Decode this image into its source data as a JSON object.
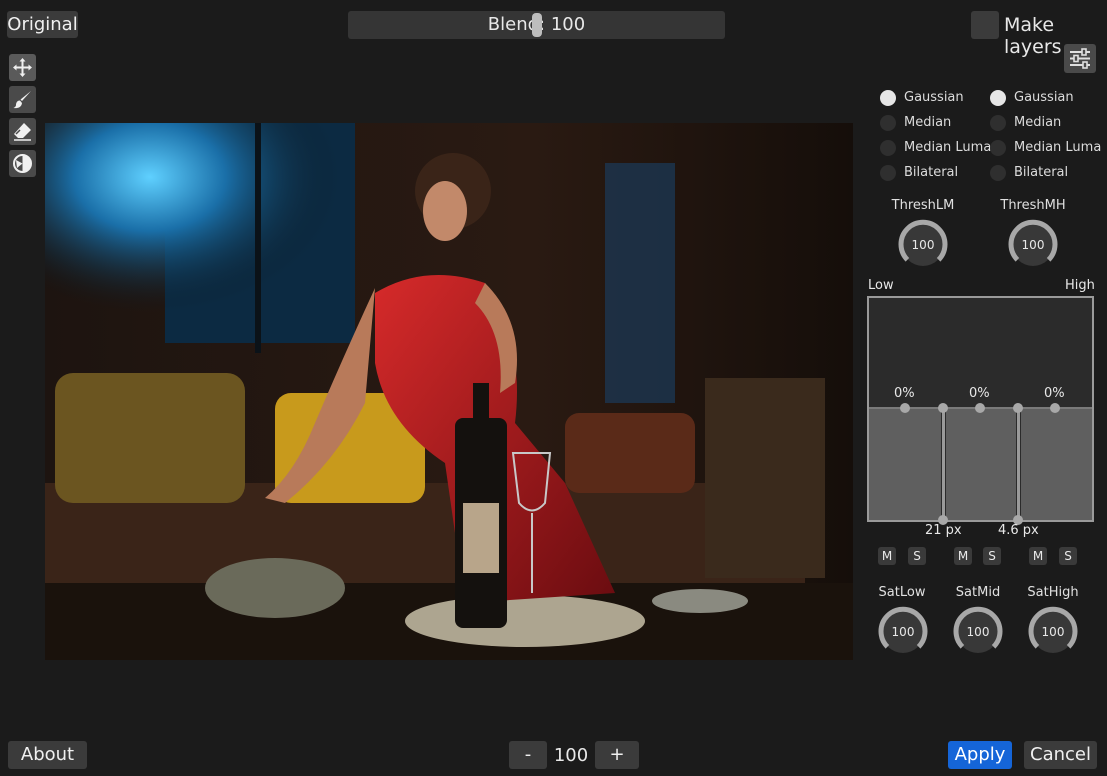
{
  "toolbar": {
    "original_label": "Original",
    "blend_label": "Blend: 100",
    "blend_value": 100,
    "make_layers_label": "Make layers",
    "make_layers_checked": false
  },
  "tools": [
    {
      "icon": "move-icon",
      "active": true
    },
    {
      "icon": "brush-icon",
      "active": false
    },
    {
      "icon": "eraser-icon",
      "active": false
    },
    {
      "icon": "contrast-icon",
      "active": false
    }
  ],
  "filters": {
    "left": [
      {
        "label": "Gaussian",
        "selected": true
      },
      {
        "label": "Median",
        "selected": false
      },
      {
        "label": "Median Luma",
        "selected": false
      },
      {
        "label": "Bilateral",
        "selected": false
      }
    ],
    "right": [
      {
        "label": "Gaussian",
        "selected": true
      },
      {
        "label": "Median",
        "selected": false
      },
      {
        "label": "Median Luma",
        "selected": false
      },
      {
        "label": "Bilateral",
        "selected": false
      }
    ]
  },
  "thresholds": {
    "lm": {
      "label": "ThreshLM",
      "value": "100"
    },
    "mh": {
      "label": "ThreshMH",
      "value": "100"
    }
  },
  "bands": {
    "low_label": "Low",
    "high_label": "High",
    "low_pct": "0%",
    "mid_pct": "0%",
    "high_pct": "0%",
    "split1": "21 px",
    "split2": "4.6 px",
    "m_label": "M",
    "s_label": "S"
  },
  "saturation": {
    "low": {
      "label": "SatLow",
      "value": "100"
    },
    "mid": {
      "label": "SatMid",
      "value": "100"
    },
    "high": {
      "label": "SatHigh",
      "value": "100"
    }
  },
  "footer": {
    "about_label": "About",
    "minus_label": "-",
    "zoom_value": "100",
    "plus_label": "+",
    "apply_label": "Apply",
    "cancel_label": "Cancel"
  },
  "colors": {
    "accent": "#1565d8",
    "background": "#1b1b1b",
    "button": "#3b3b3b"
  }
}
